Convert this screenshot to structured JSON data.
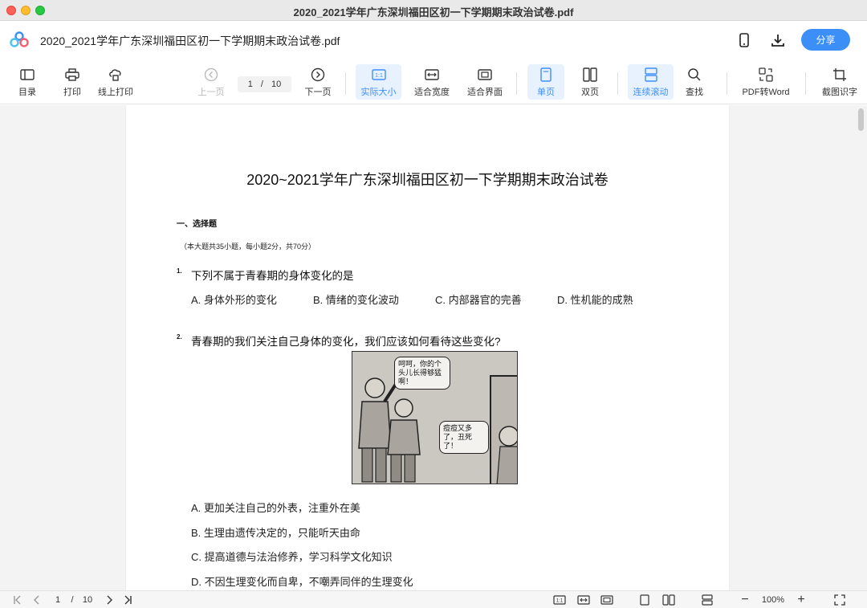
{
  "window": {
    "title": "2020_2021学年广东深圳福田区初一下学期期末政治试卷.pdf"
  },
  "header": {
    "doc_title": "2020_2021学年广东深圳福田区初一下学期期末政治试卷.pdf",
    "share_label": "分享",
    "icons": [
      "logo-icon",
      "phone-icon",
      "download-icon"
    ]
  },
  "toolbar": {
    "toc": "目录",
    "print": "打印",
    "online_print": "线上打印",
    "prev_page": "上一页",
    "page_current": "1",
    "page_sep": "/",
    "page_total": "10",
    "next_page": "下一页",
    "actual_size": "实际大小",
    "fit_width": "适合宽度",
    "fit_page": "适合界面",
    "single_page": "单页",
    "double_page": "双页",
    "continuous_scroll": "连续滚动",
    "find": "查找",
    "pdf_to_word": "PDF转Word",
    "screenshot_ocr": "截图识字"
  },
  "document": {
    "title": "2020~2021学年广东深圳福田区初一下学期期末政治试卷",
    "section": "一、选择题",
    "note": "（本大题共35小题，每小题2分，共70分）",
    "q1": {
      "num": "1.",
      "text": "下列不属于青春期的身体变化的是",
      "options": [
        "A. 身体外形的变化",
        "B. 情绪的变化波动",
        "C. 内部器官的完善",
        "D. 性机能的成熟"
      ]
    },
    "q2": {
      "num": "2.",
      "text": "青春期的我们关注自己身体的变化，我们应该如何看待这些变化?",
      "bubble1": "呵呵，你的个头儿长得够猛啊！",
      "bubble2": "痘痘又多了，丑死了！",
      "options": [
        "A. 更加关注自己的外表，注重外在美",
        "B. 生理由遗传决定的，只能听天由命",
        "C. 提高道德与法治修养，学习科学文化知识",
        "D. 不因生理变化而自卑，不嘲弄同伴的生理变化"
      ]
    }
  },
  "statusbar": {
    "page_current": "1",
    "page_sep": "/",
    "page_total": "10",
    "zoom": "100%"
  },
  "colors": {
    "accent": "#3d8ff8",
    "active_bg": "#e8f2fe"
  }
}
